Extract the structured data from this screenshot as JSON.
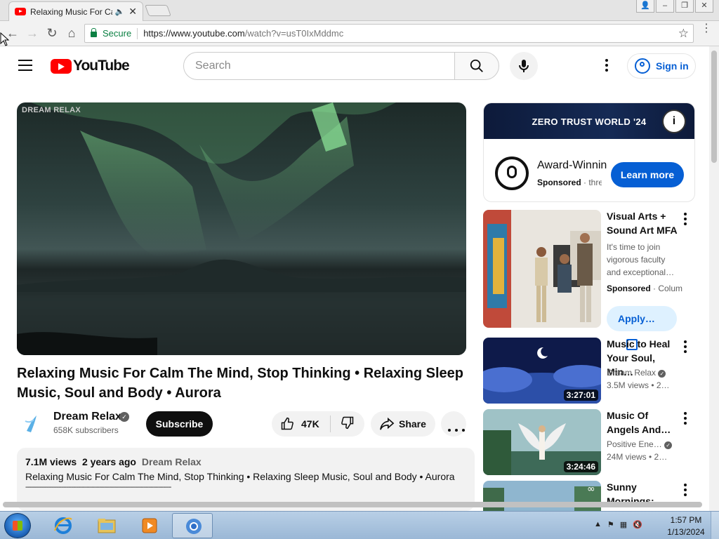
{
  "browser": {
    "tab_title": "Relaxing Music For Calm",
    "secure_label": "Secure",
    "url_host": "https://www.youtube.com",
    "url_path": "/watch?v=usT0IxMddmc"
  },
  "header": {
    "logo_text": "YouTube",
    "search_placeholder": "Search",
    "sign_in": "Sign in"
  },
  "video": {
    "watermark": "DREAM RELAX",
    "title": "Relaxing Music For Calm The Mind, Stop Thinking • Relaxing Sleep Music, Soul and Body • Aurora",
    "channel": "Dream Relax",
    "subscribers": "658K subscribers",
    "subscribe_label": "Subscribe",
    "likes": "47K",
    "share_label": "Share",
    "views": "7.1M views",
    "age": "2 years ago",
    "desc_channel": "Dream Relax",
    "description": "Relaxing Music For Calm The Mind, Stop Thinking • Relaxing Sleep Music, Soul and Body • Aurora",
    "divider": "-----------------------------------------------------------------------------------------"
  },
  "sidebar": {
    "ad": {
      "banner_text": "ZERO TRUST WORLD '24",
      "title": "Award-Winning",
      "sponsored": "Sponsored",
      "advertiser": "· threatlocker",
      "cta": "Learn more"
    },
    "promo": {
      "title": "Visual Arts + Sound Art MFA",
      "description": "It's time to join vigorous faculty and exceptional…",
      "sponsored": "Sponsored",
      "advertiser": "· Columbia",
      "cta": "Apply…"
    },
    "items": [
      {
        "title": "Music to Heal Your Soul, Min…",
        "channel": "Dream Relax",
        "meta": "3.5M views  • 2…",
        "duration": "3:27:01"
      },
      {
        "title": "Music Of Angels And…",
        "channel": "Positive Ene…",
        "meta": "24M views  • 2…",
        "duration": "3:24:46"
      },
      {
        "title": "Sunny Mornings:",
        "channel": "",
        "meta": "",
        "duration": ""
      }
    ]
  },
  "taskbar": {
    "time": "1:57 PM",
    "date": "1/13/2024"
  }
}
